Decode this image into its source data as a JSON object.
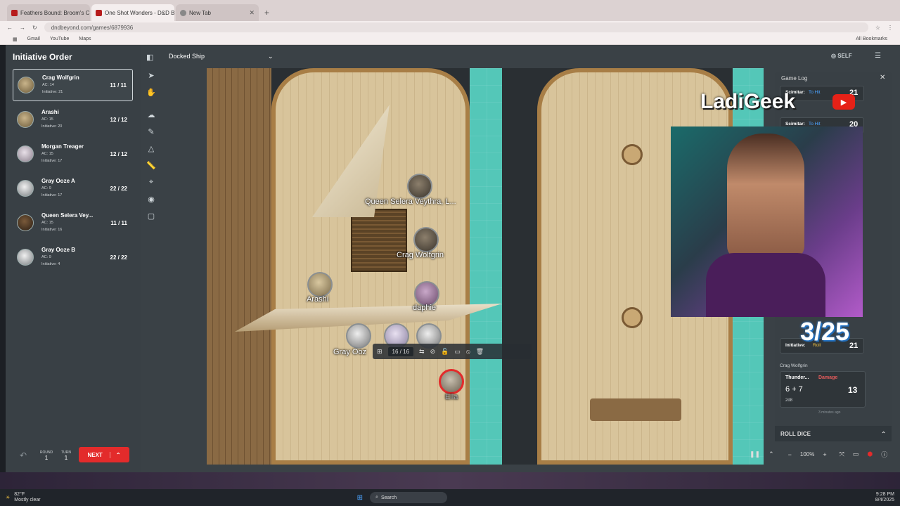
{
  "browser": {
    "tabs": [
      {
        "label": "Feathers Bound: Broom's Character"
      },
      {
        "label": "One Shot Wonders - D&D Beyond"
      },
      {
        "label": "New Tab"
      }
    ],
    "url": "dndbeyond.com/games/6879936",
    "bookmarks": [
      "Gmail",
      "YouTube",
      "Maps"
    ],
    "all_bookmarks": "All Bookmarks"
  },
  "initiative": {
    "title": "Initiative Order",
    "combatants": [
      {
        "name": "Crag Wolfgrin",
        "ac": "AC: 14",
        "init": "Initiative: 21",
        "hp": "11 / 11",
        "active": true
      },
      {
        "name": "Arashi",
        "ac": "AC: 15",
        "init": "Initiative: 20",
        "hp": "12 / 12"
      },
      {
        "name": "Morgan Treager",
        "ac": "AC: 15",
        "init": "Initiative: 17",
        "hp": "12 / 12"
      },
      {
        "name": "Gray Ooze A",
        "ac": "AC: 9",
        "init": "Initiative: 17",
        "hp": "22 / 22"
      },
      {
        "name": "Queen Selera Vey...",
        "ac": "AC: 15",
        "init": "Initiative: 16",
        "hp": "11 / 11"
      },
      {
        "name": "Gray Ooze B",
        "ac": "AC: 9",
        "init": "Initiative: 4",
        "hp": "22 / 22"
      }
    ],
    "round_label": "ROUND",
    "round": "1",
    "turn_label": "TURN",
    "turn": "1",
    "next_label": "NEXT"
  },
  "scene": {
    "name": "Docked Ship",
    "self_label": "SELF"
  },
  "tokens": {
    "labels": [
      "Queen Selera Veythra, L...",
      "Crag Wolfgrin",
      "Arashi",
      "daphie",
      "Gray Ooz",
      "Ella"
    ],
    "hp_value": "16 / 16"
  },
  "game_log": {
    "title": "Game Log",
    "entries": [
      {
        "label": "Scimitar:",
        "action": "To Hit",
        "value": "21"
      },
      {
        "label": "Scimitar:",
        "action": "To Hit",
        "value": "20"
      }
    ],
    "initiative_entry": {
      "label": "Initiative:",
      "action": "Roll",
      "value": "21"
    },
    "damage_entry": {
      "who": "Crag Wolfgrin",
      "label": "Thunder...",
      "action": "Damage",
      "formula": "6 + 7",
      "dice": "2d8",
      "value": "13",
      "time": "3 minutes ago"
    },
    "roll_dice": "ROLL DICE"
  },
  "overlay": {
    "channel": "LadiGeek",
    "counter": "3/25"
  },
  "zoom": "100%",
  "taskbar": {
    "weather_temp": "82°F",
    "weather_text": "Mostly clear",
    "search": "Search",
    "time": "9:28 PM",
    "date": "8/4/2025"
  },
  "colors": {
    "accent": "#e32b2b",
    "panel": "#394045",
    "water": "#54c7b8"
  }
}
